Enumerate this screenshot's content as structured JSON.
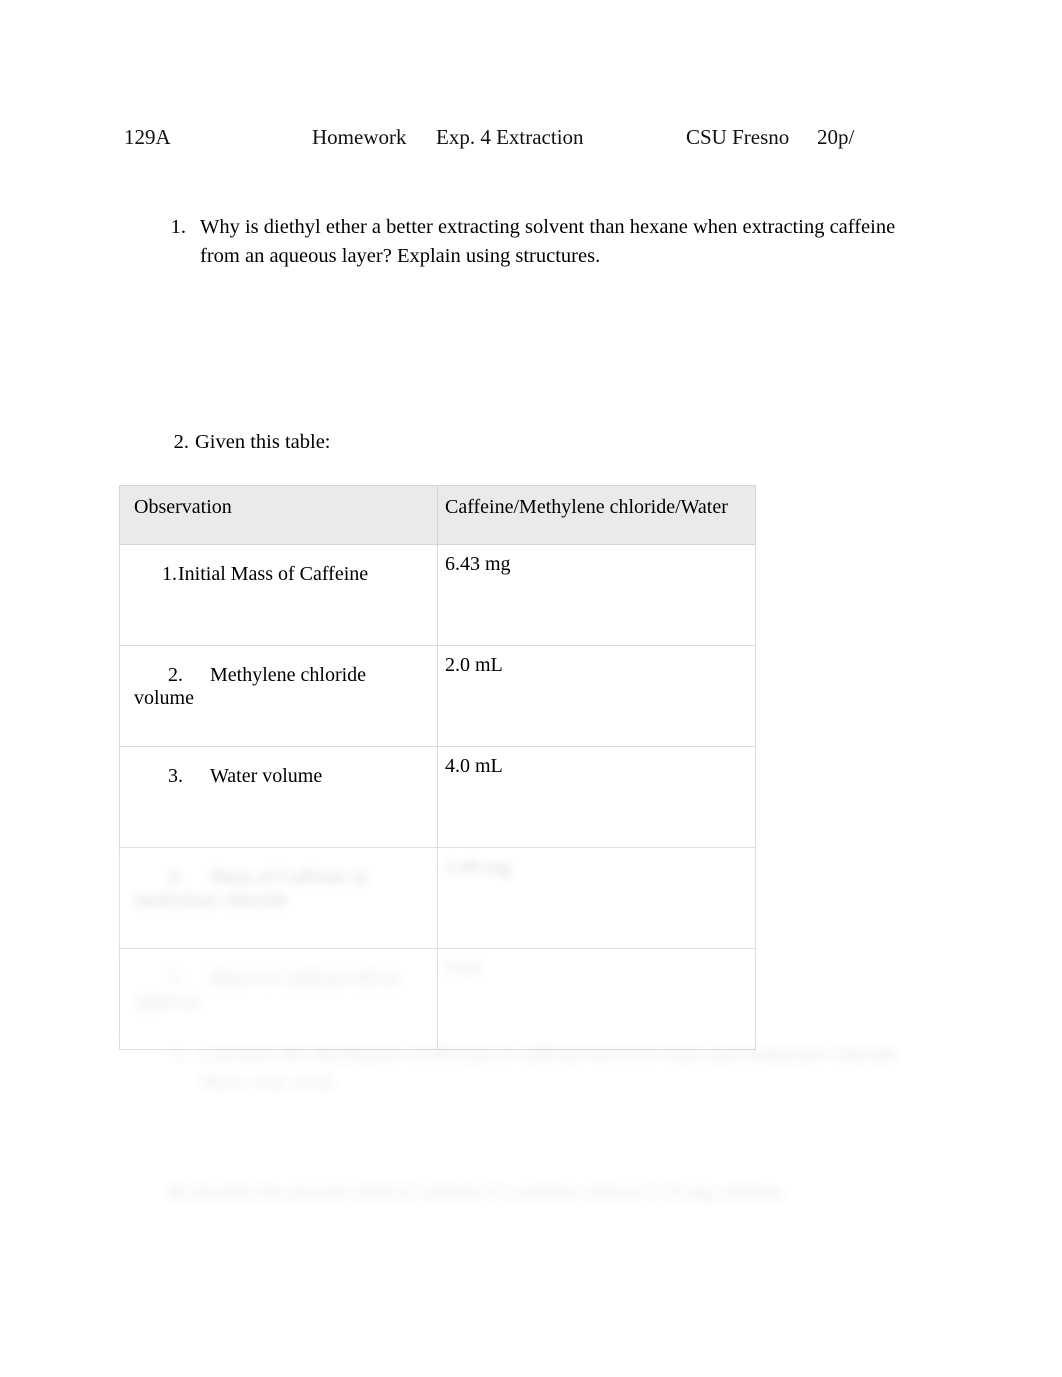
{
  "header": {
    "course": "129A",
    "doc_type": "Homework",
    "experiment": "Exp. 4 Extraction",
    "school": "CSU Fresno",
    "points": "20p/"
  },
  "questions": [
    {
      "number": "1.",
      "text": "Why is diethyl ether a better extracting solvent than hexane when extracting caffeine from an aqueous layer? Explain using structures."
    },
    {
      "number": "2.",
      "text": "Given this table:"
    },
    {
      "number": "3.",
      "text": "Calculate the distribution coefficient of caffeine between water and methylene chloride. Show your work."
    },
    {
      "number": "4.",
      "text": "Calculate the percent yield of caffeine if a student collects 3.25 mg caffeine."
    }
  ],
  "table": {
    "columns": [
      "Observation",
      "Caffeine/Methylene chloride/Water"
    ],
    "rows": [
      {
        "number": "1.",
        "observation": "Initial Mass of Caffeine",
        "value": "6.43 mg"
      },
      {
        "number": "2.",
        "observation": "Methylene chloride volume",
        "value": "2.0 mL"
      },
      {
        "number": "3.",
        "observation": "Water volume",
        "value": "4.0 mL"
      },
      {
        "number": "4.",
        "observation": "Mass of Caffeine in methylene chloride",
        "value": "5.49 mg"
      },
      {
        "number": "5.",
        "observation": "Mass of Caffeine left in aqueous",
        "value": "0.94"
      }
    ]
  }
}
